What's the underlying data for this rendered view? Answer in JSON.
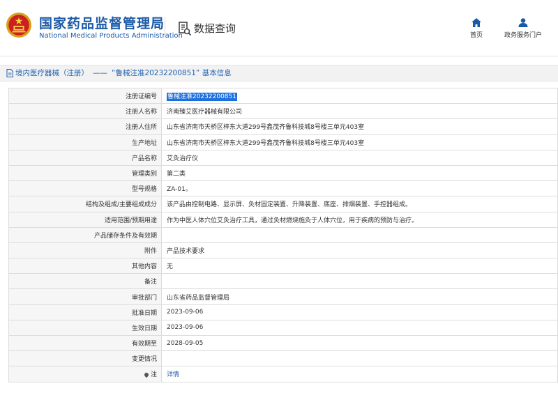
{
  "header": {
    "brand_cn": "国家药品监督管理局",
    "brand_en": "National Medical Products Administration",
    "section_title": "数据查询",
    "nav": [
      {
        "label": "首页",
        "icon": "home-icon"
      },
      {
        "label": "政务服务门户",
        "icon": "user-icon"
      }
    ],
    "colors": {
      "brand": "#1b5aa6",
      "highlight": "#1e6fe0"
    }
  },
  "breadcrumb": {
    "category": "境内医疗器械（注册）",
    "separator": "——",
    "current": "“鲁械注准20232200851” 基本信息"
  },
  "record": [
    {
      "label": "注册证编号",
      "value": "鲁械注准20232200851"
    },
    {
      "label": "注册人名称",
      "value": "济南臻艾医疗器械有限公司"
    },
    {
      "label": "注册人住所",
      "value": "山东省济南市天桥区梓东大道299号鑫茂齐鲁科技城8号楼三单元403室"
    },
    {
      "label": "生产地址",
      "value": "山东省济南市天桥区梓东大道299号鑫茂齐鲁科技城8号楼三单元403室"
    },
    {
      "label": "产品名称",
      "value": "艾灸治疗仪"
    },
    {
      "label": "管理类别",
      "value": "第二类"
    },
    {
      "label": "型号规格",
      "value": "ZA-01。"
    },
    {
      "label": "结构及组成/主要组成成分",
      "value": "该产品由控制电路、显示屏、灸材固定装置、升降装置、底座、排烟装置、手控器组成。"
    },
    {
      "label": "适用范围/预期用途",
      "value": "作为中医人体穴位艾灸治疗工具，通过灸材燃烧施灸于人体穴位，用于疾病的预防与治疗。"
    },
    {
      "label": "产品储存条件及有效期",
      "value": ""
    },
    {
      "label": "附件",
      "value": "产品技术要求"
    },
    {
      "label": "其他内容",
      "value": "无"
    },
    {
      "label": "备注",
      "value": ""
    },
    {
      "label": "审批部门",
      "value": "山东省药品监督管理局"
    },
    {
      "label": "批准日期",
      "value": "2023-09-06"
    },
    {
      "label": "生效日期",
      "value": "2023-09-06"
    },
    {
      "label": "有效期至",
      "value": "2028-09-05"
    },
    {
      "label": "变更情况",
      "value": ""
    },
    {
      "label": "注",
      "value": "详情"
    }
  ]
}
